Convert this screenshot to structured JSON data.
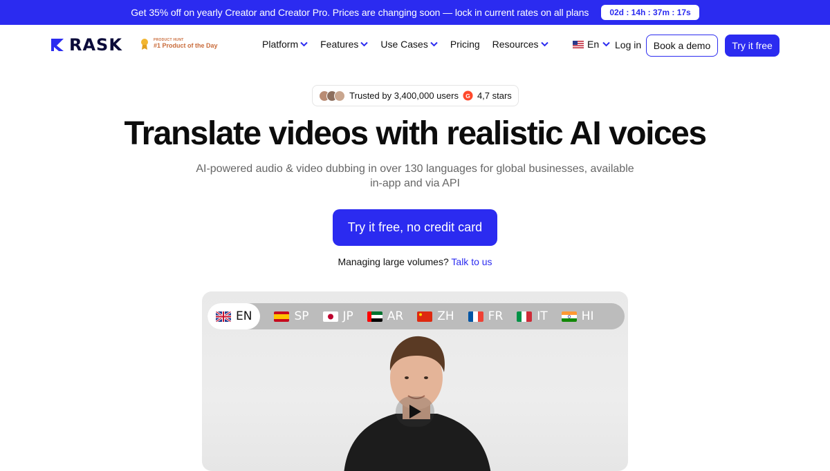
{
  "promo": {
    "text": "Get 35% off on yearly Creator and Creator Pro. Prices are changing soon — lock in current rates on all plans",
    "countdown": "02d : 14h : 37m : 17s"
  },
  "nav": {
    "logo_text": "RASK",
    "product_hunt_small": "PRODUCT HUNT",
    "product_hunt_label": "#1 Product of the Day",
    "links": [
      {
        "label": "Platform",
        "has_dropdown": true
      },
      {
        "label": "Features",
        "has_dropdown": true
      },
      {
        "label": "Use Cases",
        "has_dropdown": true
      },
      {
        "label": "Pricing",
        "has_dropdown": false
      },
      {
        "label": "Resources",
        "has_dropdown": true
      }
    ],
    "language": "En",
    "login": "Log in",
    "book_demo": "Book a demo",
    "try_free": "Try it free"
  },
  "hero": {
    "trust_text": "Trusted by 3,400,000 users",
    "rating_text": "4,7 stars",
    "headline": "Translate videos with realistic AI voices",
    "subhead": "AI-powered audio & video dubbing in over 130 languages for global businesses, available in-app and via API",
    "cta": "Try it free, no credit card",
    "volumes_text": "Managing large volumes?",
    "volumes_link": "Talk to us"
  },
  "video": {
    "languages": [
      {
        "code": "EN",
        "flag": "uk-flag-icon",
        "active": true
      },
      {
        "code": "SP",
        "flag": "spain-flag-icon",
        "active": false
      },
      {
        "code": "JP",
        "flag": "japan-flag-icon",
        "active": false
      },
      {
        "code": "AR",
        "flag": "uae-flag-icon",
        "active": false
      },
      {
        "code": "ZH",
        "flag": "china-flag-icon",
        "active": false
      },
      {
        "code": "FR",
        "flag": "france-flag-icon",
        "active": false
      },
      {
        "code": "IT",
        "flag": "italy-flag-icon",
        "active": false
      },
      {
        "code": "HI",
        "flag": "india-flag-icon",
        "active": false
      }
    ]
  },
  "colors": {
    "brand": "#2b2bf0",
    "ph_orange": "#c96b3a"
  }
}
